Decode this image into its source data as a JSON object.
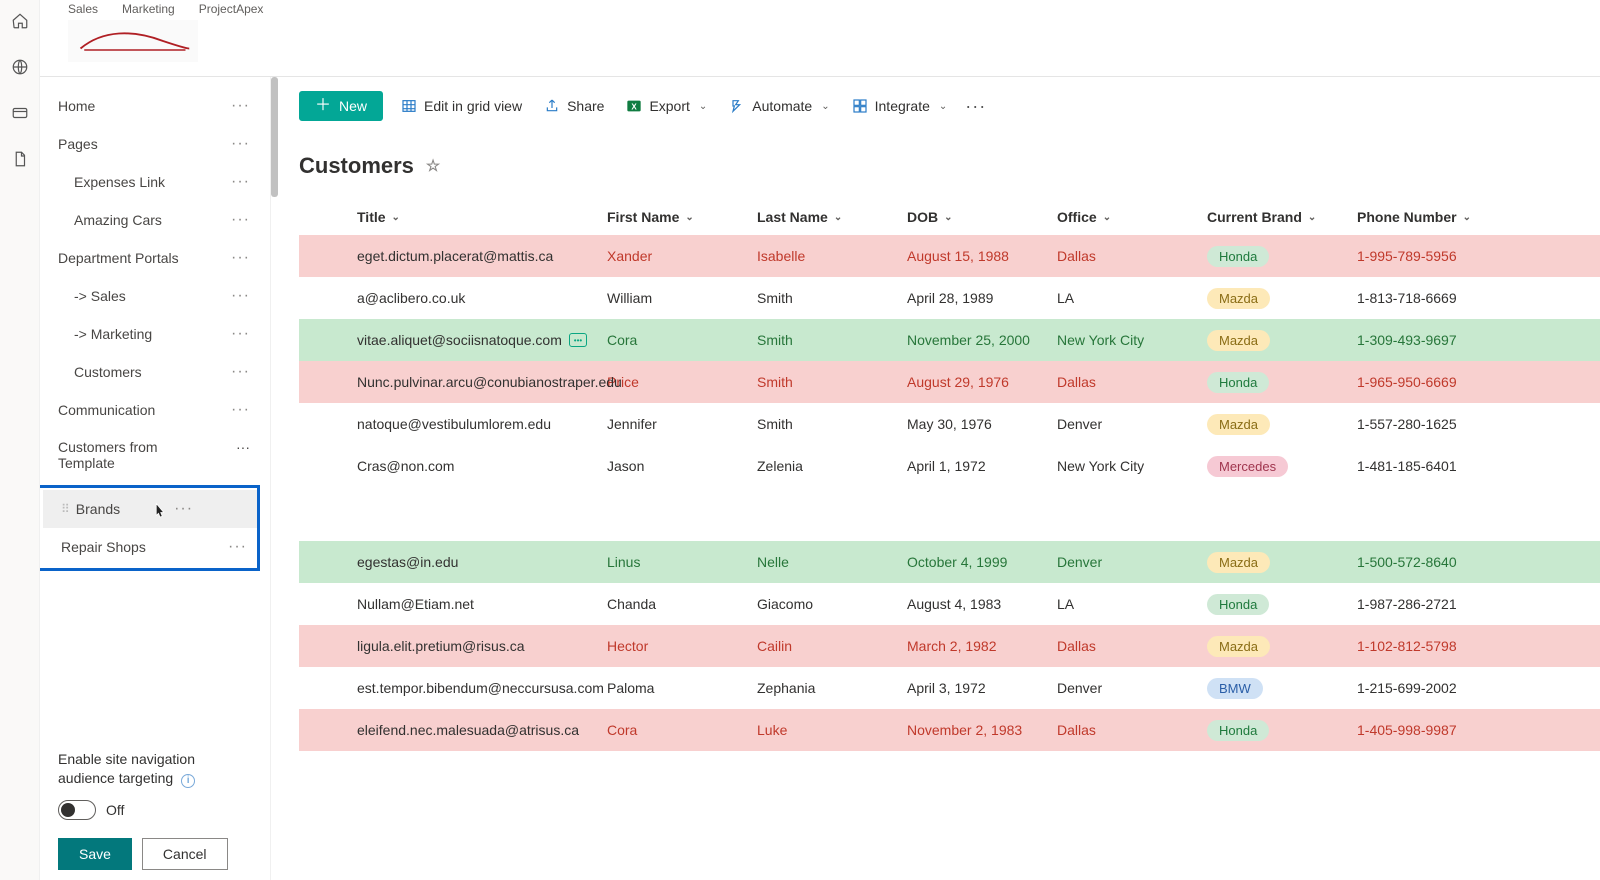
{
  "topTabs": [
    "Sales",
    "Marketing",
    "ProjectApex"
  ],
  "rail": [
    "home-icon",
    "globe-icon",
    "card-icon",
    "file-icon"
  ],
  "nav": {
    "items": [
      {
        "label": "Home",
        "sub": false
      },
      {
        "label": "Pages",
        "sub": false
      },
      {
        "label": "Expenses Link",
        "sub": true
      },
      {
        "label": "Amazing Cars",
        "sub": true
      },
      {
        "label": "Department Portals",
        "sub": false
      },
      {
        "label": "-> Sales",
        "sub": true
      },
      {
        "label": "-> Marketing",
        "sub": true
      },
      {
        "label": "Customers",
        "sub": true
      },
      {
        "label": "Communication",
        "sub": false
      }
    ],
    "multiline": "Customers from Template",
    "highlighted": [
      {
        "label": "Brands",
        "hover": true,
        "grip": true
      },
      {
        "label": "Repair Shops",
        "hover": false,
        "grip": false
      }
    ]
  },
  "navBottom": {
    "label": "Enable site navigation audience targeting",
    "toggleState": "Off",
    "save": "Save",
    "cancel": "Cancel"
  },
  "commandBar": {
    "newLabel": "New",
    "items": [
      {
        "icon": "grid-icon",
        "label": "Edit in grid view",
        "chev": false
      },
      {
        "icon": "share-icon",
        "label": "Share",
        "chev": false
      },
      {
        "icon": "excel-icon",
        "label": "Export",
        "chev": true
      },
      {
        "icon": "automate-icon",
        "label": "Automate",
        "chev": true
      },
      {
        "icon": "integrate-icon",
        "label": "Integrate",
        "chev": true
      }
    ]
  },
  "list": {
    "title": "Customers",
    "columns": [
      "Title",
      "First Name",
      "Last Name",
      "DOB",
      "Office",
      "Current Brand",
      "Phone Number"
    ],
    "rows": [
      {
        "style": "red",
        "title": "eget.dictum.placerat@mattis.ca",
        "fn": "Xander",
        "ln": "Isabelle",
        "dob": "August 15, 1988",
        "office": "Dallas",
        "brand": "Honda",
        "phone": "1-995-789-5956",
        "comment": false
      },
      {
        "style": "",
        "title": "a@aclibero.co.uk",
        "fn": "William",
        "ln": "Smith",
        "dob": "April 28, 1989",
        "office": "LA",
        "brand": "Mazda",
        "phone": "1-813-718-6669",
        "comment": false
      },
      {
        "style": "green",
        "title": "vitae.aliquet@sociisnatoque.com",
        "fn": "Cora",
        "ln": "Smith",
        "dob": "November 25, 2000",
        "office": "New York City",
        "brand": "Mazda",
        "phone": "1-309-493-9697",
        "comment": true
      },
      {
        "style": "red",
        "title": "Nunc.pulvinar.arcu@conubianostraper.edu",
        "fn": "Price",
        "ln": "Smith",
        "dob": "August 29, 1976",
        "office": "Dallas",
        "brand": "Honda",
        "phone": "1-965-950-6669",
        "comment": false
      },
      {
        "style": "",
        "title": "natoque@vestibulumlorem.edu",
        "fn": "Jennifer",
        "ln": "Smith",
        "dob": "May 30, 1976",
        "office": "Denver",
        "brand": "Mazda",
        "phone": "1-557-280-1625",
        "comment": false
      },
      {
        "style": "",
        "title": "Cras@non.com",
        "fn": "Jason",
        "ln": "Zelenia",
        "dob": "April 1, 1972",
        "office": "New York City",
        "brand": "Mercedes",
        "phone": "1-481-185-6401",
        "comment": false
      }
    ],
    "rows2": [
      {
        "style": "green",
        "title": "egestas@in.edu",
        "fn": "Linus",
        "ln": "Nelle",
        "dob": "October 4, 1999",
        "office": "Denver",
        "brand": "Mazda",
        "phone": "1-500-572-8640",
        "comment": false
      },
      {
        "style": "",
        "title": "Nullam@Etiam.net",
        "fn": "Chanda",
        "ln": "Giacomo",
        "dob": "August 4, 1983",
        "office": "LA",
        "brand": "Honda",
        "phone": "1-987-286-2721",
        "comment": false
      },
      {
        "style": "red",
        "title": "ligula.elit.pretium@risus.ca",
        "fn": "Hector",
        "ln": "Cailin",
        "dob": "March 2, 1982",
        "office": "Dallas",
        "brand": "Mazda",
        "phone": "1-102-812-5798",
        "comment": false
      },
      {
        "style": "",
        "title": "est.tempor.bibendum@neccursusa.com",
        "fn": "Paloma",
        "ln": "Zephania",
        "dob": "April 3, 1972",
        "office": "Denver",
        "brand": "BMW",
        "phone": "1-215-699-2002",
        "comment": false
      },
      {
        "style": "red",
        "title": "eleifend.nec.malesuada@atrisus.ca",
        "fn": "Cora",
        "ln": "Luke",
        "dob": "November 2, 1983",
        "office": "Dallas",
        "brand": "Honda",
        "phone": "1-405-998-9987",
        "comment": false
      }
    ]
  }
}
